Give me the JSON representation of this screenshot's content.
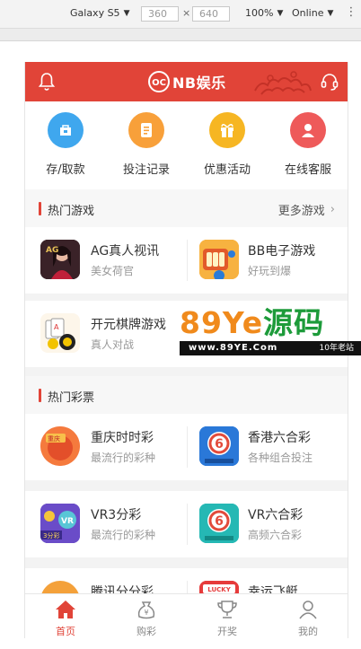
{
  "devtools": {
    "device": "Galaxy S5",
    "width": "360",
    "height": "640",
    "times": "×",
    "zoom": "100%",
    "network": "Online"
  },
  "header": {
    "brand": "NB娱乐",
    "color": "#e14438"
  },
  "quick_actions": [
    {
      "label": "存/取款",
      "icon": "wallet-icon",
      "color": "#3fa7ee"
    },
    {
      "label": "投注记录",
      "icon": "record-icon",
      "color": "#f8a03a"
    },
    {
      "label": "优惠活动",
      "icon": "gift-icon",
      "color": "#f6b623"
    },
    {
      "label": "在线客服",
      "icon": "service-icon",
      "color": "#ee5a5a"
    }
  ],
  "hot_games": {
    "title": "热门游戏",
    "more": "更多游戏",
    "items": [
      {
        "name": "AG真人视讯",
        "desc": "美女荷官"
      },
      {
        "name": "BB电子游戏",
        "desc": "好玩到爆"
      },
      {
        "name": "开元棋牌游戏",
        "desc": "真人对战"
      }
    ]
  },
  "hot_lottery": {
    "title": "热门彩票",
    "items": [
      {
        "name": "重庆时时彩",
        "desc": "最流行的彩种"
      },
      {
        "name": "香港六合彩",
        "desc": "各种组合投注"
      },
      {
        "name": "VR3分彩",
        "desc": "最流行的彩种"
      },
      {
        "name": "VR六合彩",
        "desc": "高频六合彩"
      },
      {
        "name": "腾讯分分彩",
        "desc": ""
      },
      {
        "name": "幸运飞艇",
        "desc": ""
      }
    ]
  },
  "watermark": {
    "big_left": "89Ye",
    "big_right": "源码",
    "url": "www.89YE.Com",
    "tagline": "10年老站"
  },
  "tabbar": [
    {
      "label": "首页",
      "active": true
    },
    {
      "label": "购彩",
      "active": false
    },
    {
      "label": "开奖",
      "active": false
    },
    {
      "label": "我的",
      "active": false
    }
  ]
}
